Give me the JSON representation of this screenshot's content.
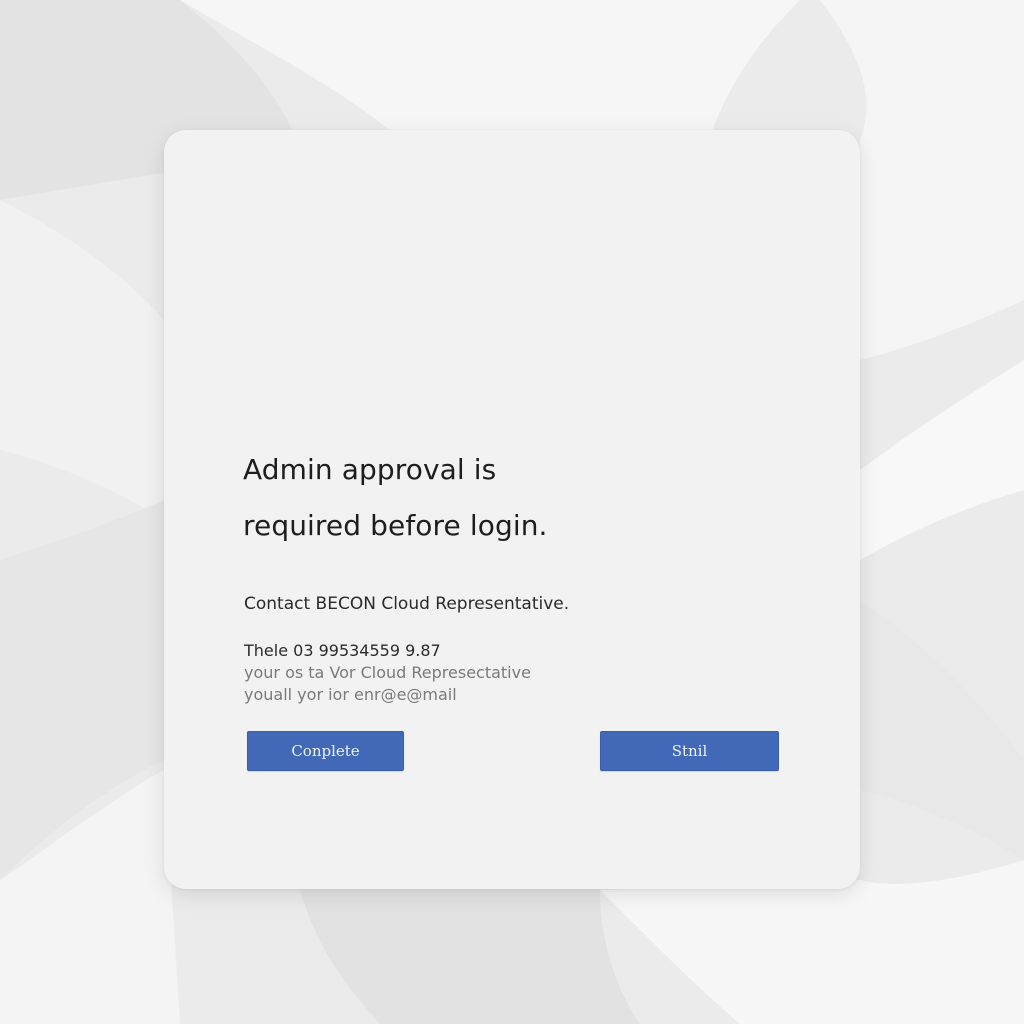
{
  "dialog": {
    "heading_line1": "Admin approval is",
    "heading_line2": "required before login.",
    "contact_text": "Contact BECON Cloud Representative.",
    "detail_lines": [
      "Thele 03 99534559 9.87",
      "your os ta Vor Cloud Represectative",
      "youall yor ior enr@e@mail"
    ],
    "buttons": {
      "left_label": "Conplete",
      "right_label": "Stnil"
    }
  },
  "colors": {
    "background": "#ececec",
    "card": "#f2f2f2",
    "button": "#4169b8"
  }
}
